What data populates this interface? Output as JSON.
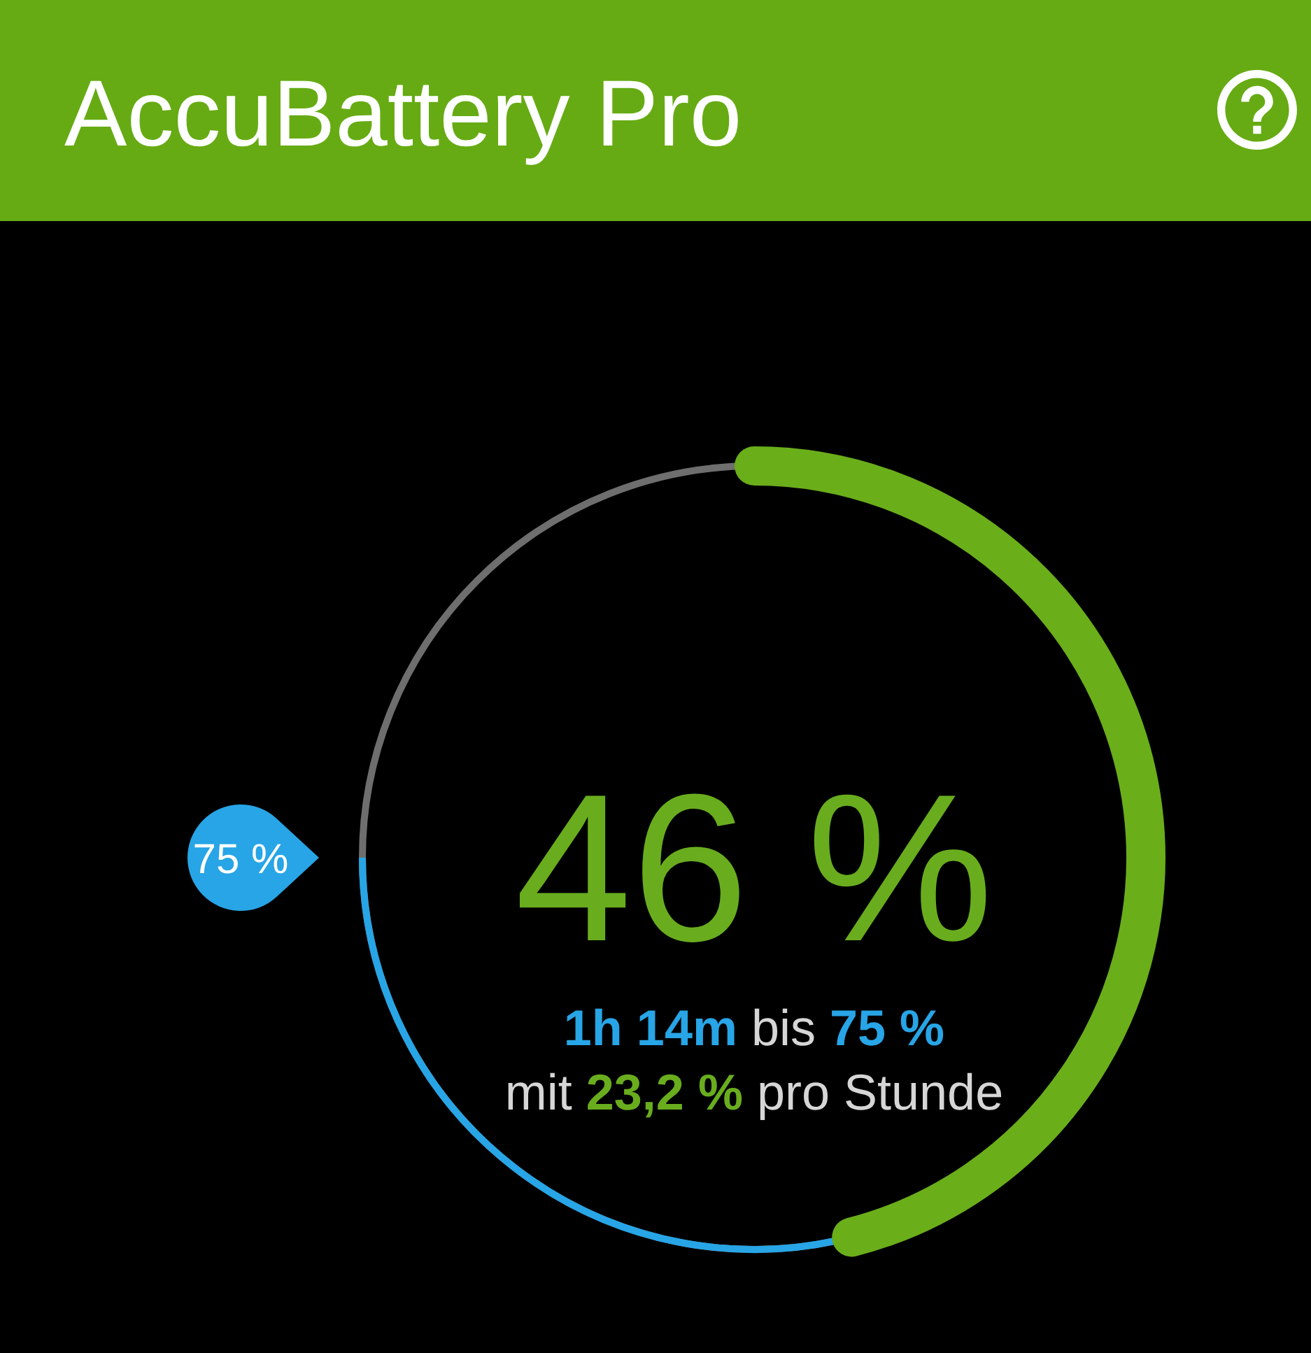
{
  "app_bar": {
    "title": "AccuBattery Pro"
  },
  "charge_ring": {
    "level": 0.46,
    "percent": "46 %",
    "target": {
      "label": "75 %"
    },
    "estimate": "**1h 14m** bis **75 %**",
    "rate": "mit **23,2 %** pro Stunde"
  }
}
